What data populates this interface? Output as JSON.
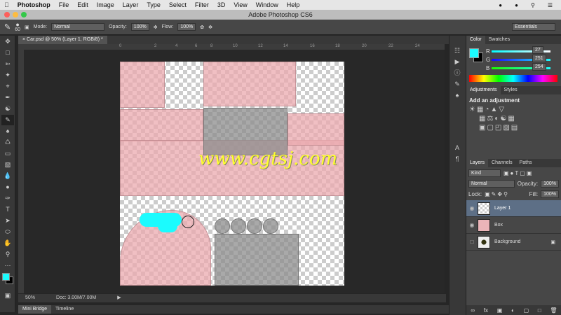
{
  "menubar": {
    "app": "Photoshop",
    "items": [
      "File",
      "Edit",
      "Image",
      "Layer",
      "Type",
      "Select",
      "Filter",
      "3D",
      "View",
      "Window",
      "Help"
    ]
  },
  "title": "Adobe Photoshop CS6",
  "options": {
    "brush_size": "60",
    "mode_label": "Mode:",
    "mode_value": "Normal",
    "opacity_label": "Opacity:",
    "opacity_value": "100%",
    "flow_label": "Flow:",
    "flow_value": "100%",
    "workspace": "Essentials"
  },
  "doc_tab": "Car.psd @ 50% (Layer 1, RGB/8) *",
  "ruler": [
    "0",
    "2",
    "4",
    "6",
    "8",
    "10",
    "12",
    "14",
    "16",
    "18",
    "20",
    "22",
    "24"
  ],
  "watermark": "www.cgtsj.com",
  "status": {
    "zoom": "50%",
    "doc": "Doc: 3.00M/7.00M"
  },
  "bottom_tabs": [
    "Mini Bridge",
    "Timeline"
  ],
  "color_panel": {
    "tabs": [
      "Color",
      "Swatches"
    ],
    "r_label": "R",
    "g_label": "G",
    "b_label": "B",
    "r": "27",
    "g": "251",
    "b": "254",
    "fg": "#1bfbfe",
    "bg": "#000000"
  },
  "adjustments": {
    "tabs": [
      "Adjustments",
      "Styles"
    ],
    "heading": "Add an adjustment"
  },
  "layers_panel": {
    "tabs": [
      "Layers",
      "Channels",
      "Paths"
    ],
    "kind": "Kind",
    "blend": "Normal",
    "opacity_label": "Opacity:",
    "opacity": "100%",
    "lock_label": "Lock:",
    "fill_label": "Fill:",
    "fill": "100%",
    "layers": [
      {
        "name": "Layer 1"
      },
      {
        "name": "Box"
      },
      {
        "name": "Background"
      }
    ]
  }
}
